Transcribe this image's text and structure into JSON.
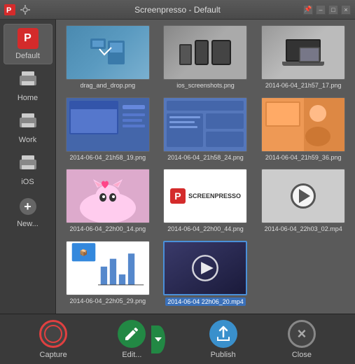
{
  "titlebar": {
    "title": "Screenpresso  -  Default",
    "pin_label": "📌",
    "min_label": "–",
    "max_label": "□",
    "close_label": "×"
  },
  "sidebar": {
    "items": [
      {
        "id": "default",
        "label": "Default",
        "active": true
      },
      {
        "id": "home",
        "label": "Home"
      },
      {
        "id": "work",
        "label": "Work"
      },
      {
        "id": "ios",
        "label": "iOS"
      },
      {
        "id": "new",
        "label": "New..."
      }
    ]
  },
  "grid": {
    "items": [
      {
        "id": "item1",
        "label": "drag_and_drop.png",
        "type": "drag_drop"
      },
      {
        "id": "item2",
        "label": "ios_screenshots.png",
        "type": "ios"
      },
      {
        "id": "item3",
        "label": "2014-06-04_21h57_17.png",
        "type": "laptop"
      },
      {
        "id": "item4",
        "label": "2014-06-04_21h58_19.png",
        "type": "blue_screen"
      },
      {
        "id": "item5",
        "label": "2014-06-04_21h58_24.png",
        "type": "dashboard"
      },
      {
        "id": "item6",
        "label": "2014-06-04_21h59_36.png",
        "type": "person"
      },
      {
        "id": "item7",
        "label": "2014-06-04_22h00_14.png",
        "type": "cat"
      },
      {
        "id": "item8",
        "label": "2014-06-04_22h00_44.png",
        "type": "screenpresso"
      },
      {
        "id": "item9",
        "label": "2014-06-04_22h03_02.mp4",
        "type": "video"
      },
      {
        "id": "item10",
        "label": "2014-06-04_22h05_29.png",
        "type": "chart"
      },
      {
        "id": "item11",
        "label": "2014-06-04 22h06_20.mp4",
        "type": "video2",
        "selected": true
      }
    ]
  },
  "toolbar": {
    "capture_label": "Capture",
    "edit_label": "Edit...",
    "publish_label": "Publish",
    "close_label": "Close"
  }
}
